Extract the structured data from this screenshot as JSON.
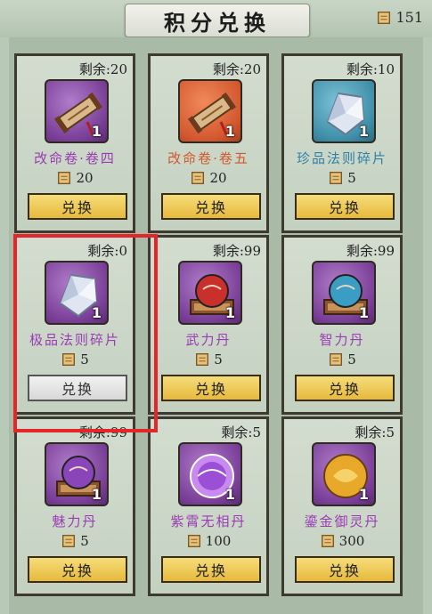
{
  "header": {
    "title": "积分兑换",
    "points": "151",
    "points_icon": "scroll-icon"
  },
  "colors": {
    "accent": "#e4262b",
    "button": "#f0cc57",
    "purple_text": "#9b3bb5",
    "orange_text": "#d2582c"
  },
  "items": [
    {
      "remain": "剩余:20",
      "name": "改命卷·卷四",
      "price": "20",
      "qty": "1",
      "button": "兑换",
      "icon": "scroll-item-icon",
      "bg": "purple",
      "name_color": "#9b3bb5",
      "enabled": true
    },
    {
      "remain": "剩余:20",
      "name": "改命卷·卷五",
      "price": "20",
      "qty": "1",
      "button": "兑换",
      "icon": "scroll-item-icon",
      "bg": "orange",
      "name_color": "#d2582c",
      "enabled": true
    },
    {
      "remain": "剩余:10",
      "name": "珍品法则碎片",
      "price": "5",
      "qty": "1",
      "button": "兑换",
      "icon": "crystal-shard-icon",
      "bg": "blue",
      "name_color": "#2f7fa6",
      "enabled": true
    },
    {
      "remain": "剩余:0",
      "name": "极品法则碎片",
      "price": "5",
      "qty": "1",
      "button": "兑换",
      "icon": "crystal-shard-icon",
      "bg": "purple",
      "name_color": "#9b3bb5",
      "enabled": false
    },
    {
      "remain": "剩余:99",
      "name": "武力丹",
      "price": "5",
      "qty": "1",
      "button": "兑换",
      "icon": "red-orb-icon",
      "bg": "purple",
      "name_color": "#9b3bb5",
      "enabled": true
    },
    {
      "remain": "剩余:99",
      "name": "智力丹",
      "price": "5",
      "qty": "1",
      "button": "兑换",
      "icon": "blue-orb-icon",
      "bg": "purple",
      "name_color": "#9b3bb5",
      "enabled": true
    },
    {
      "remain": "剩余:99",
      "name": "魅力丹",
      "price": "5",
      "qty": "1",
      "button": "兑换",
      "icon": "purple-orb-icon",
      "bg": "purple",
      "name_color": "#9b3bb5",
      "enabled": true
    },
    {
      "remain": "剩余:5",
      "name": "紫霄无相丹",
      "price": "100",
      "qty": "1",
      "button": "兑换",
      "icon": "glowing-purple-pill-icon",
      "bg": "purple",
      "name_color": "#9b3bb5",
      "enabled": true
    },
    {
      "remain": "剩余:5",
      "name": "鎏金御灵丹",
      "price": "300",
      "qty": "1",
      "button": "兑换",
      "icon": "golden-pill-icon",
      "bg": "purple",
      "name_color": "#9b3bb5",
      "enabled": true
    }
  ]
}
